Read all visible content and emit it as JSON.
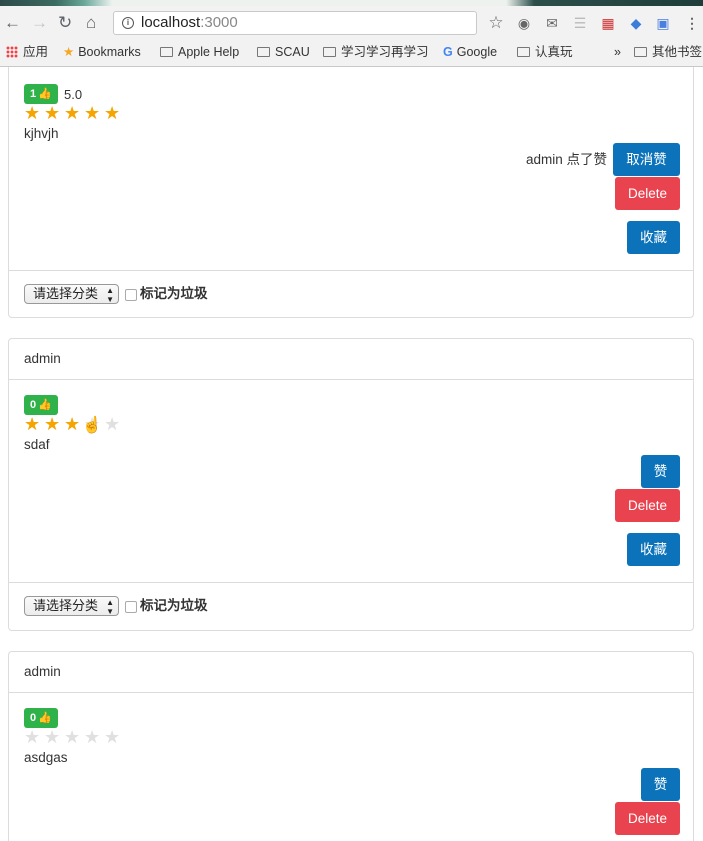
{
  "browser": {
    "url_host": "localhost",
    "url_port": ":3000",
    "bookmarks": [
      {
        "label": "应用",
        "icon": "apps-grid-icon"
      },
      {
        "label": "Bookmarks",
        "icon": "star-icon"
      },
      {
        "label": "Apple Help",
        "icon": "folder-icon"
      },
      {
        "label": "SCAU",
        "icon": "folder-icon"
      },
      {
        "label": "学习学习再学习",
        "icon": "folder-icon"
      },
      {
        "label": "Google",
        "icon": "google-icon"
      },
      {
        "label": "认真玩",
        "icon": "folder-icon"
      },
      {
        "label": "其他书签",
        "icon": "folder-icon"
      }
    ],
    "overflow_label": "»"
  },
  "posts": [
    {
      "author": "",
      "likes": "1",
      "score": "5.0",
      "rating": 5,
      "content": "kjhvjh",
      "liked_by_text": "admin 点了赞",
      "like_button": "取消赞",
      "delete_button": "Delete",
      "favorite_button": "收藏",
      "category_select": "请选择分类",
      "spam_label": "标记为垃圾"
    },
    {
      "author": "admin",
      "likes": "0",
      "score": "",
      "rating": 3,
      "content": "sdaf",
      "liked_by_text": "",
      "like_button": "赞",
      "delete_button": "Delete",
      "favorite_button": "收藏",
      "category_select": "请选择分类",
      "spam_label": "标记为垃圾"
    },
    {
      "author": "admin",
      "likes": "0",
      "score": "",
      "rating": 0,
      "content": "asdgas",
      "liked_by_text": "",
      "like_button": "赞",
      "delete_button": "Delete",
      "favorite_button": "",
      "category_select": "",
      "spam_label": ""
    }
  ],
  "colors": {
    "primary": "#0c73ba",
    "danger": "#e8434f",
    "success": "#2fb24a",
    "star": "#f5a400"
  }
}
